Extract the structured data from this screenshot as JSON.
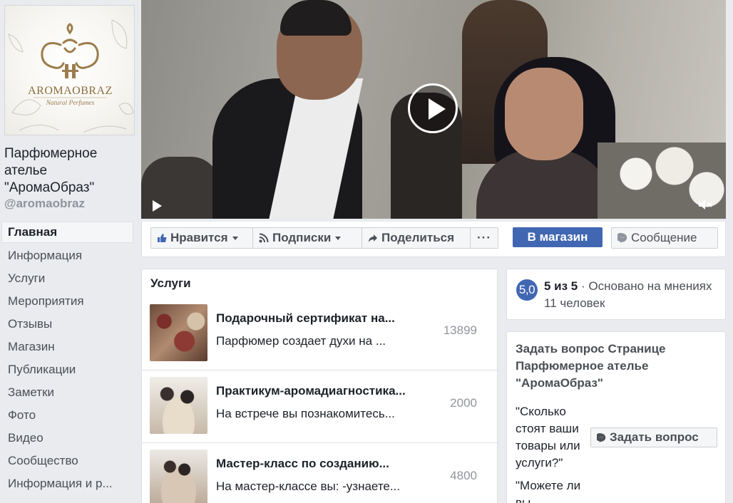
{
  "page": {
    "name": "Парфюмерное ателье \"АромаОбраз\"",
    "handle": "@aromaobraz",
    "logo": {
      "brand": "AROMAOBRAZ",
      "tagline": "Natural Perfumes",
      "color": "#8a6d3b"
    }
  },
  "nav": {
    "items": [
      {
        "label": "Главная",
        "active": true
      },
      {
        "label": "Информация"
      },
      {
        "label": "Услуги"
      },
      {
        "label": "Мероприятия"
      },
      {
        "label": "Отзывы"
      },
      {
        "label": "Магазин"
      },
      {
        "label": "Публикации"
      },
      {
        "label": "Заметки"
      },
      {
        "label": "Фото"
      },
      {
        "label": "Видео"
      },
      {
        "label": "Сообщество"
      },
      {
        "label": "Информация и р..."
      }
    ]
  },
  "actions": {
    "like": "Нравится",
    "follow": "Подписки",
    "share": "Поделиться",
    "more": "···",
    "shop": "В магазин",
    "message": "Сообщение",
    "accent": "#4267b2"
  },
  "services": {
    "title": "Услуги",
    "items": [
      {
        "name": "Подарочный сертификат на...",
        "desc": "Парфюмер создает духи на ...",
        "price": "13899"
      },
      {
        "name": "Практикум-аромадиагностика...",
        "desc": "На встрече вы познакомитесь...",
        "price": "2000"
      },
      {
        "name": "Мастер-класс по созданию...",
        "desc": "На мастер-классе вы: -узнаете...",
        "price": "4800"
      }
    ]
  },
  "rating": {
    "badge": "5,0",
    "score": "5 из 5",
    "text": " · Основано на мнениях 11 человек"
  },
  "ask": {
    "title": "Задать вопрос Странице Парфюмерное ателье \"АромаОбраз\"",
    "q1": "\"Сколько стоят ваши товары или услуги?\"",
    "button": "Задать вопрос",
    "q2": "\"Можете ли вы"
  }
}
